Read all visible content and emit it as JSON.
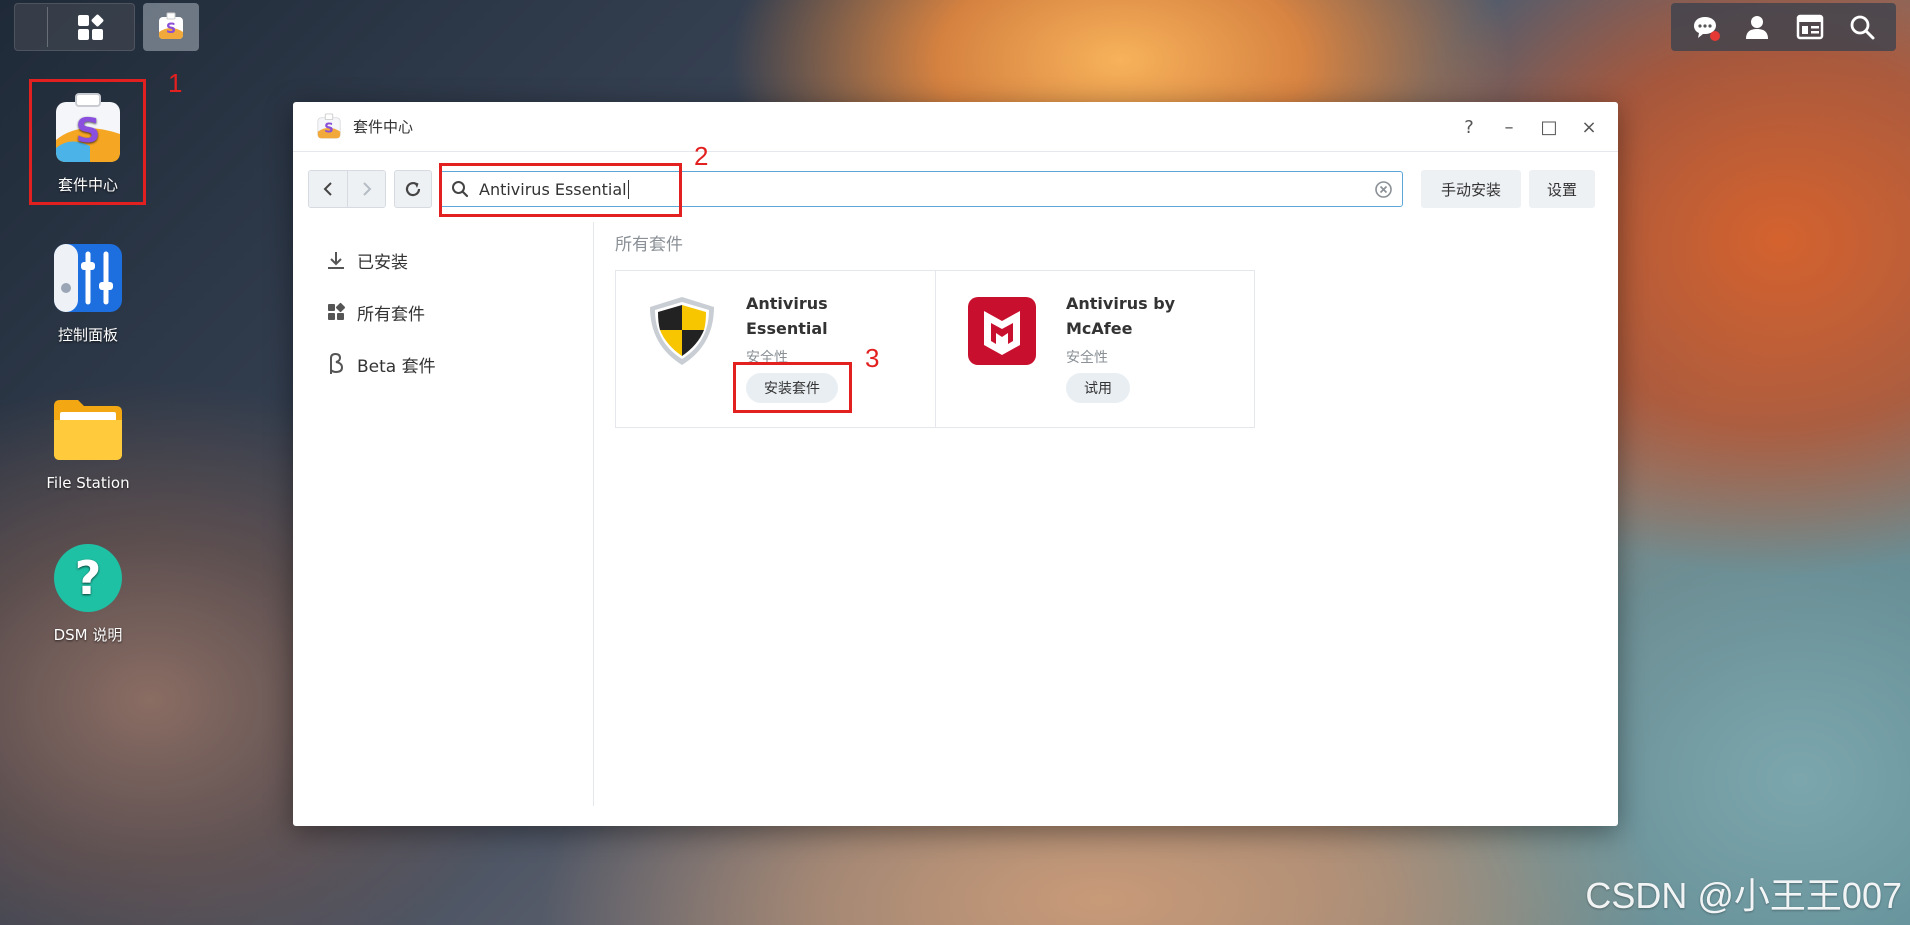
{
  "taskbar": {
    "main_menu_icon": "grid-icon",
    "open_app_icon": "package-center-icon",
    "right_icons": [
      "chat-icon",
      "user-icon",
      "widgets-icon",
      "search-icon"
    ]
  },
  "desktop": {
    "icons": [
      {
        "label": "套件中心",
        "icon": "package-center-icon"
      },
      {
        "label": "控制面板",
        "icon": "control-panel-icon"
      },
      {
        "label": "File Station",
        "icon": "folder-icon"
      },
      {
        "label": "DSM 说明",
        "icon": "help-icon"
      }
    ]
  },
  "annotations": {
    "marker_1": "1",
    "marker_2": "2",
    "marker_3": "3",
    "color": "#e32020"
  },
  "window": {
    "title": "套件中心",
    "controls": [
      "?",
      "–",
      "□",
      "×"
    ],
    "search": {
      "value": "Antivirus Essential"
    },
    "manual_install_label": "手动安装",
    "settings_label": "设置",
    "sidebar": [
      {
        "label": "已安装",
        "icon": "download-icon"
      },
      {
        "label": "所有套件",
        "icon": "grid-icon"
      },
      {
        "label": "Beta 套件",
        "icon": "beta-icon"
      }
    ],
    "section_title": "所有套件",
    "packages": [
      {
        "name": "Antivirus Essential",
        "category": "安全性",
        "action": "安装套件",
        "icon": "shield-icon"
      },
      {
        "name": "Antivirus by McAfee",
        "category": "安全性",
        "action": "试用",
        "icon": "mcafee-icon"
      }
    ]
  },
  "watermark": "CSDN @小王王007",
  "colors": {
    "accent": "#5ca6d8",
    "annotation": "#e32020"
  }
}
